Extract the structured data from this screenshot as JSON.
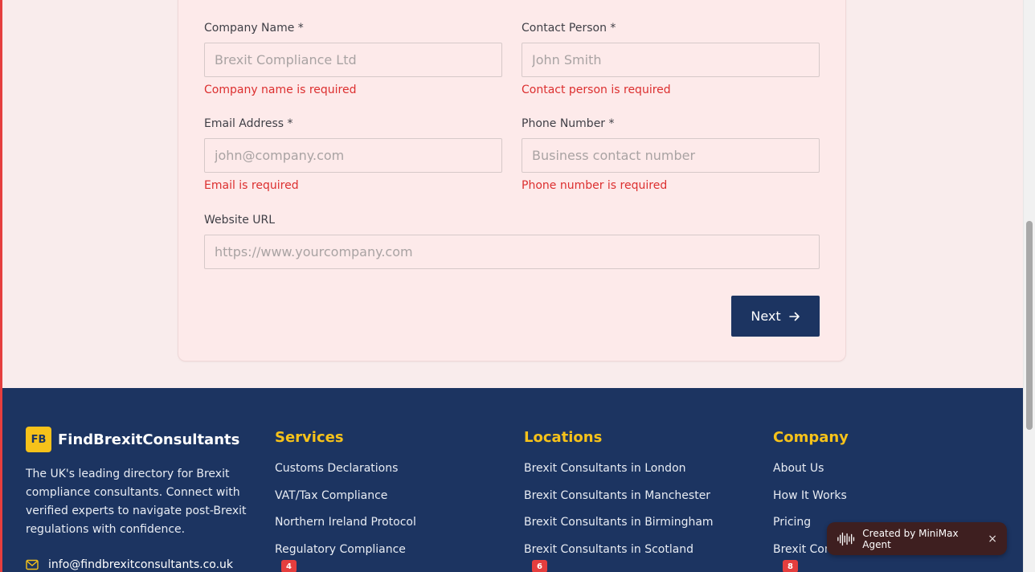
{
  "form": {
    "company_name": {
      "label": "Company Name *",
      "placeholder": "Brexit Compliance Ltd",
      "error": "Company name is required"
    },
    "contact_person": {
      "label": "Contact Person *",
      "placeholder": "John Smith",
      "error": "Contact person is required"
    },
    "email": {
      "label": "Email Address *",
      "placeholder": "john@company.com",
      "error": "Email is required"
    },
    "phone": {
      "label": "Phone Number *",
      "placeholder": "Business contact number",
      "error": "Phone number is required"
    },
    "website": {
      "label": "Website URL",
      "placeholder": "https://www.yourcompany.com"
    },
    "next_label": "Next"
  },
  "footer": {
    "brand": {
      "logo": "FB",
      "name": "FindBrexitConsultants",
      "description": "The UK's leading directory for Brexit compliance consultants. Connect with verified experts to navigate post-Brexit regulations with confidence.",
      "email": "info@findbrexitconsultants.co.uk"
    },
    "services": {
      "title": "Services",
      "items": [
        "Customs Declarations",
        "VAT/Tax Compliance",
        "Northern Ireland Protocol",
        "Regulatory Compliance"
      ]
    },
    "locations": {
      "title": "Locations",
      "items": [
        "Brexit Consultants in London",
        "Brexit Consultants in Manchester",
        "Brexit Consultants in Birmingham",
        "Brexit Consultants in Scotland"
      ]
    },
    "company": {
      "title": "Company",
      "items": [
        "About Us",
        "How It Works",
        "Pricing",
        "Brexit Compliance Guide"
      ]
    },
    "badges": [
      "4",
      "6",
      "8"
    ]
  },
  "toast": {
    "text": "Created by MiniMax Agent",
    "close": "×"
  },
  "colors": {
    "navy": "#1c3461",
    "gold": "#f6c21a",
    "error": "#dc2f2f",
    "card_bg": "#fdeaea"
  },
  "icons": [
    "arrow-right-icon",
    "mail-icon",
    "waveform-icon",
    "close-icon"
  ]
}
